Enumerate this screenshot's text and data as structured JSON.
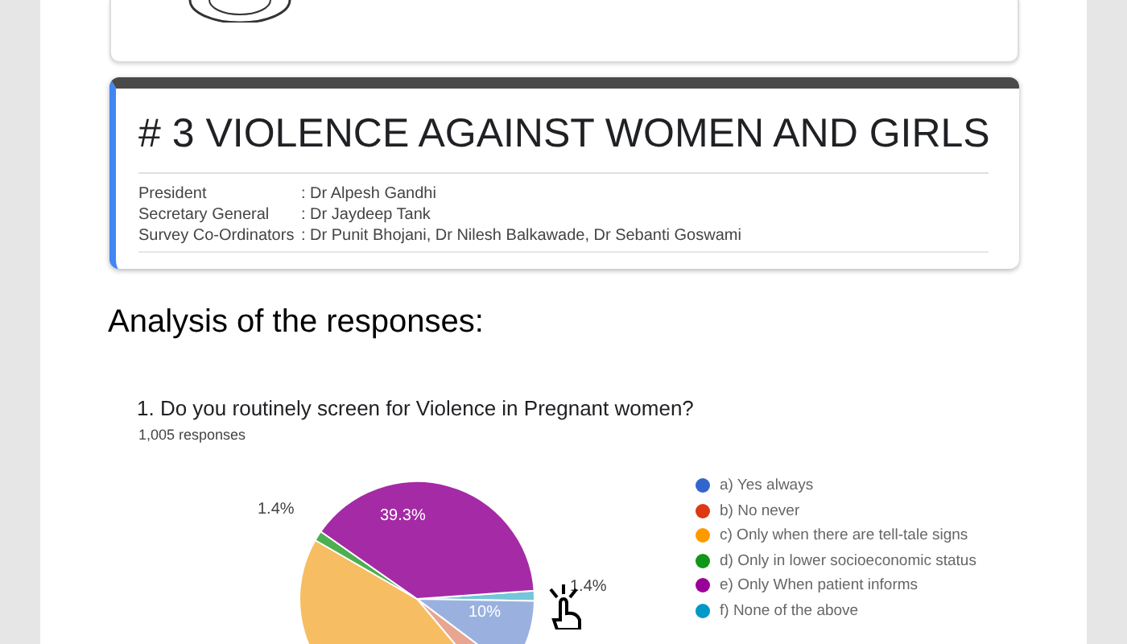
{
  "section_card": {
    "title": "# 3 VIOLENCE AGAINST WOMEN AND GIRLS",
    "rows": [
      {
        "label": "President",
        "value": ": Dr Alpesh Gandhi"
      },
      {
        "label": "Secretary General",
        "value": ": Dr Jaydeep Tank"
      },
      {
        "label": "Survey Co-Ordinators",
        "value": ": Dr Punit Bhojani, Dr Nilesh Balkawade, Dr Sebanti Goswami"
      }
    ]
  },
  "heading": "Analysis of the responses:",
  "question": {
    "title": "1. Do you routinely screen for Violence in Pregnant women?",
    "count": "1,005 responses",
    "slice_labels": [
      {
        "text": "39.3%",
        "kind": "inside"
      },
      {
        "text": "10%",
        "kind": "inside"
      },
      {
        "text": "1.4%",
        "kind": "left"
      },
      {
        "text": "1.4%",
        "kind": "right"
      }
    ],
    "legend": [
      {
        "label": "a) Yes always",
        "color": "#3366cc"
      },
      {
        "label": "b) No never",
        "color": "#dc3912"
      },
      {
        "label": "c) Only when there are tell-tale signs",
        "color": "#ff9900"
      },
      {
        "label": "d) Only in lower socioeconomic status",
        "color": "#109618"
      },
      {
        "label": "e) Only When patient informs",
        "color": "#990099"
      },
      {
        "label": "f) None of the above",
        "color": "#0099c6"
      }
    ]
  }
}
